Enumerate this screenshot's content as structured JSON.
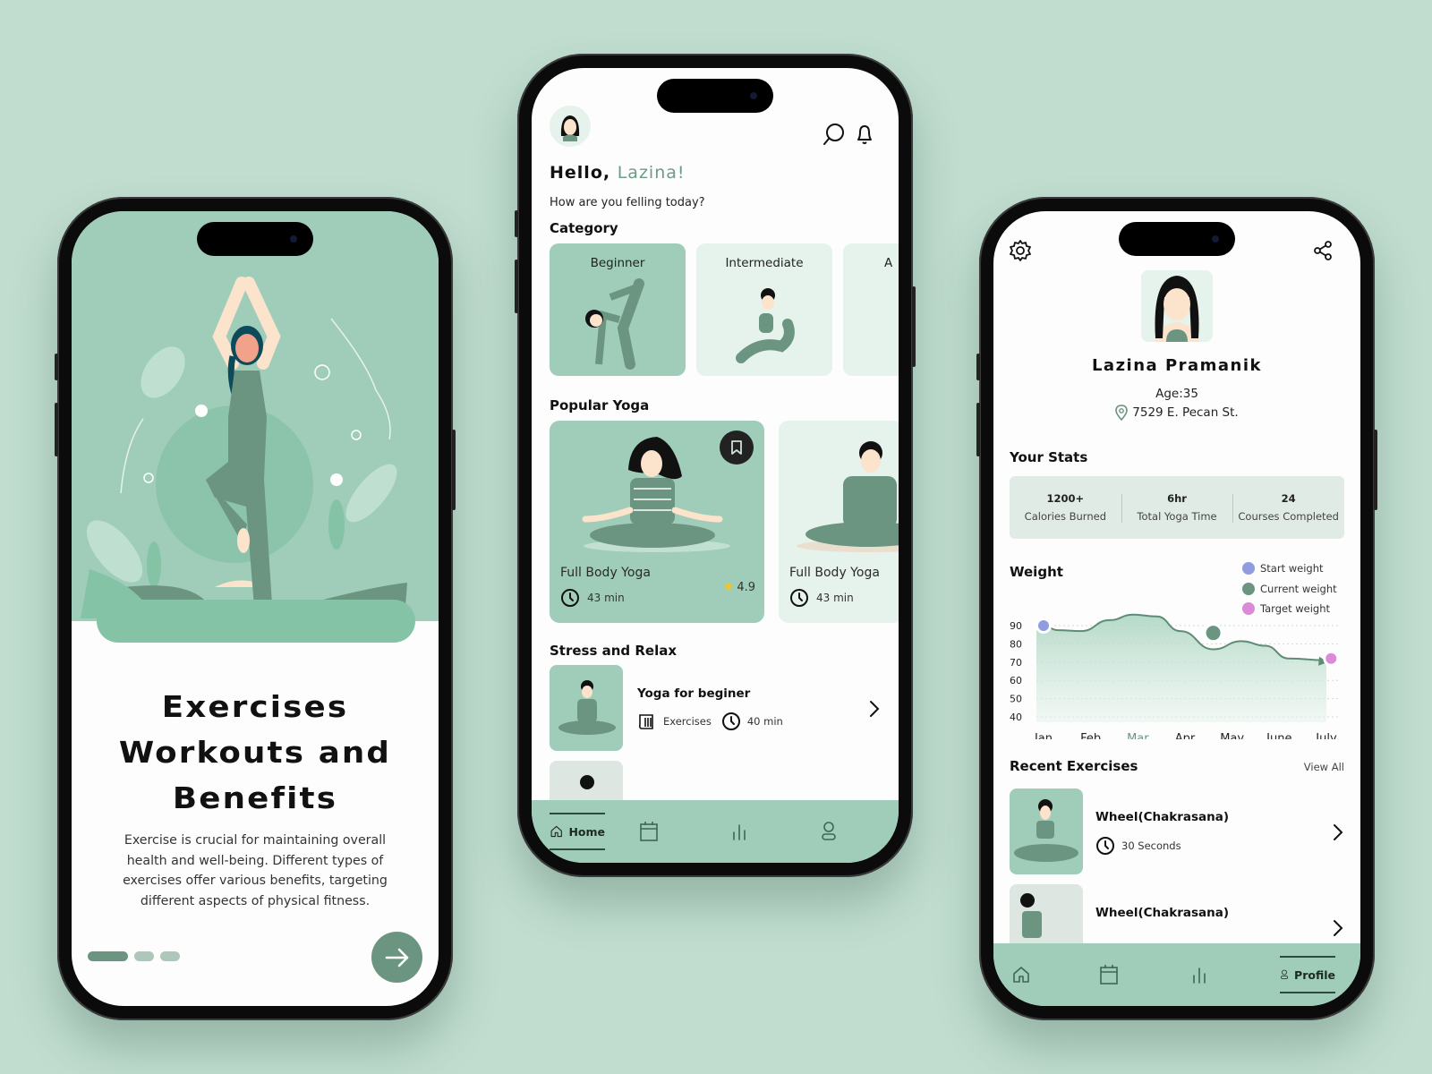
{
  "onboarding": {
    "title_lines": [
      "Exercises",
      "Workouts and",
      "Benefits"
    ],
    "body": "Exercise is crucial for maintaining overall health and well-being. Different types of exercises offer various benefits, targeting different aspects of physical fitness.",
    "pagination": {
      "total": 3,
      "active_index": 0
    },
    "next_icon": "arrow-right-icon",
    "colors": {
      "hero_bg": "#9fcdb9",
      "accent": "#6b9580"
    }
  },
  "home": {
    "greeting_prefix": "Hello,",
    "greeting_name": "Lazina!",
    "subtitle": "How are you felling today?",
    "header_icons": [
      "search-icon",
      "bell-icon"
    ],
    "category_title": "Category",
    "categories": [
      {
        "label": "Beginner",
        "selected": true
      },
      {
        "label": "Intermediate",
        "selected": false
      },
      {
        "label": "A",
        "selected": false
      }
    ],
    "popular_title": "Popular Yoga",
    "popular": [
      {
        "title": "Full Body Yoga",
        "duration": "43 min",
        "rating": "4.9",
        "bookmarked": true
      },
      {
        "title": "Full Body Yoga",
        "duration": "43 min"
      }
    ],
    "stress_title": "Stress and Relax",
    "stress_items": [
      {
        "title": "Yoga for beginer",
        "type": "Exercises",
        "duration": "40 min"
      }
    ],
    "nav": [
      {
        "label": "Home",
        "icon": "home-icon",
        "active": true
      },
      {
        "label": "",
        "icon": "calendar-icon",
        "active": false
      },
      {
        "label": "",
        "icon": "stats-icon",
        "active": false
      },
      {
        "label": "",
        "icon": "user-icon",
        "active": false
      }
    ]
  },
  "profile": {
    "header_icons": [
      "gear-icon",
      "share-icon"
    ],
    "name": "Lazina Pramanik",
    "age": "Age:35",
    "address": "7529 E. Pecan St.",
    "stats_title": "Your Stats",
    "stats": [
      {
        "value": "1200+",
        "label": "Calories Burned"
      },
      {
        "value": "6hr",
        "label": "Total Yoga Time"
      },
      {
        "value": "24",
        "label": "Courses Completed"
      }
    ],
    "recent_title": "Recent Exercises",
    "view_all": "View All",
    "recent": [
      {
        "title": "Wheel(Chakrasana)",
        "duration": "30 Seconds"
      },
      {
        "title": "Wheel(Chakrasana)",
        "duration": ""
      }
    ],
    "nav": [
      {
        "label": "",
        "icon": "home-icon",
        "active": false
      },
      {
        "label": "",
        "icon": "calendar-icon",
        "active": false
      },
      {
        "label": "",
        "icon": "stats-icon",
        "active": false
      },
      {
        "label": "Profile",
        "icon": "user-icon",
        "active": true
      }
    ]
  },
  "chart_data": {
    "type": "area",
    "title": "Weight",
    "categories": [
      "Jan",
      "Feb",
      "Mar",
      "Apr",
      "May",
      "June",
      "July"
    ],
    "highlighted_category": "Mar",
    "series": [
      {
        "name": "Weight",
        "x": [
          0,
          0.3,
          0.8,
          1.4,
          1.9,
          2.4,
          2.9,
          3.6,
          4.2,
          4.7,
          5.2,
          6.0,
          6.35
        ],
        "values": [
          90,
          87.5,
          87,
          93,
          96,
          95,
          87,
          77,
          81.5,
          79,
          72,
          71
        ]
      }
    ],
    "markers": [
      {
        "name": "Start weight",
        "x": 0,
        "value": 90,
        "color": "#8f9de0"
      },
      {
        "name": "Current weight",
        "x": 3.6,
        "value": 86,
        "color": "#6b9580"
      },
      {
        "name": "Target weight",
        "x": 6.1,
        "value": 72,
        "color": "#d98ad8"
      }
    ],
    "legend": [
      {
        "label": "Start weight",
        "color": "#8f9de0"
      },
      {
        "label": "Current weight",
        "color": "#6b9580"
      },
      {
        "label": "Target weight",
        "color": "#d98ad8"
      }
    ],
    "legend_position": "top-right",
    "yticks": [
      90,
      80,
      70,
      60,
      50,
      40
    ],
    "ylim": [
      40,
      100
    ],
    "grid": true,
    "line_color": "#5e8c75"
  }
}
